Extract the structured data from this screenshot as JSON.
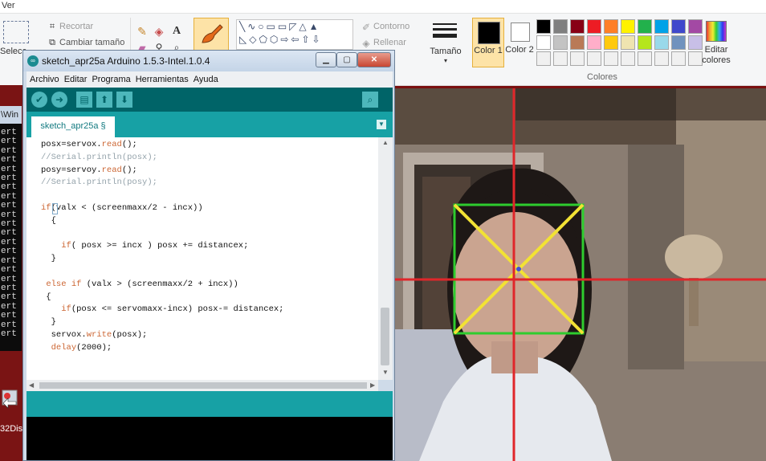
{
  "paint": {
    "menu_label": "Ver",
    "select_label": "Selecc",
    "crop_label": "Recortar",
    "resize_label": "Cambiar tamaño",
    "outline_label": "Contorno",
    "fill_label": "Rellenar",
    "size_label": "Tamaño",
    "color1_label": "Color 1",
    "color2_label": "Color 2",
    "colors_group_label": "Colores",
    "edit_colors_label": "Editar colores",
    "palette_row1": [
      "#000000",
      "#7f7f7f",
      "#880015",
      "#ed1c24",
      "#ff7f27",
      "#fff200",
      "#22b14c",
      "#00a2e8",
      "#3f48cc",
      "#a349a4"
    ],
    "palette_row2": [
      "#ffffff",
      "#c3c3c3",
      "#b97a57",
      "#ffaec9",
      "#ffc90e",
      "#efe4b0",
      "#b5e61d",
      "#99d9ea",
      "#7092be",
      "#c8bfe7"
    ]
  },
  "console_behind": {
    "title": "\\Win",
    "lines": [
      "ert",
      "ert",
      "ert",
      "ert",
      "ert",
      "ert",
      "ert",
      "ert",
      "ert",
      "ert",
      "ert",
      "ert",
      "ert",
      "ert",
      "ert",
      "ert",
      "ert",
      "ert",
      "ert",
      "ert",
      "ert",
      "ert",
      "ert"
    ]
  },
  "desktop": {
    "icon_label": "32Dis"
  },
  "arduino": {
    "title": "sketch_apr25a Arduino 1.5.3-Intel.1.0.4",
    "menu": [
      "Archivo",
      "Editar",
      "Programa",
      "Herramientas",
      "Ayuda"
    ],
    "tab_label": "sketch_apr25a §",
    "code_lines": [
      [
        {
          "t": "posx=servox.",
          "c": ""
        },
        {
          "t": "read",
          "c": "kw"
        },
        {
          "t": "();",
          "c": ""
        }
      ],
      [
        {
          "t": "//Serial.println(posx);",
          "c": "cm"
        }
      ],
      [
        {
          "t": "posy=servoy.",
          "c": ""
        },
        {
          "t": "read",
          "c": "kw"
        },
        {
          "t": "();",
          "c": ""
        }
      ],
      [
        {
          "t": "//Serial.println(posy);",
          "c": "cm"
        }
      ],
      [
        {
          "t": "",
          "c": ""
        }
      ],
      [
        {
          "t": "if",
          "c": "kw"
        },
        {
          "t": "(valx < (screenmaxx/2 - incx))",
          "c": ""
        }
      ],
      [
        {
          "t": "  {",
          "c": ""
        }
      ],
      [
        {
          "t": "",
          "c": ""
        }
      ],
      [
        {
          "t": "    ",
          "c": ""
        },
        {
          "t": "if",
          "c": "kw"
        },
        {
          "t": "( posx >= incx ) posx += distancex;",
          "c": ""
        }
      ],
      [
        {
          "t": "  }",
          "c": ""
        }
      ],
      [
        {
          "t": "",
          "c": ""
        }
      ],
      [
        {
          "t": " ",
          "c": ""
        },
        {
          "t": "else if",
          "c": "kw"
        },
        {
          "t": " (valx > (screenmaxx/2 + incx))",
          "c": ""
        }
      ],
      [
        {
          "t": " {",
          "c": ""
        }
      ],
      [
        {
          "t": "    ",
          "c": ""
        },
        {
          "t": "if",
          "c": "kw"
        },
        {
          "t": "(posx <= servomaxx-incx) posx-= distancex;",
          "c": ""
        }
      ],
      [
        {
          "t": "  }",
          "c": ""
        }
      ],
      [
        {
          "t": "  servox.",
          "c": ""
        },
        {
          "t": "write",
          "c": "kw"
        },
        {
          "t": "(posx);",
          "c": ""
        }
      ],
      [
        {
          "t": "  ",
          "c": ""
        },
        {
          "t": "delay",
          "c": "kw"
        },
        {
          "t": "(2000);",
          "c": ""
        }
      ]
    ]
  }
}
